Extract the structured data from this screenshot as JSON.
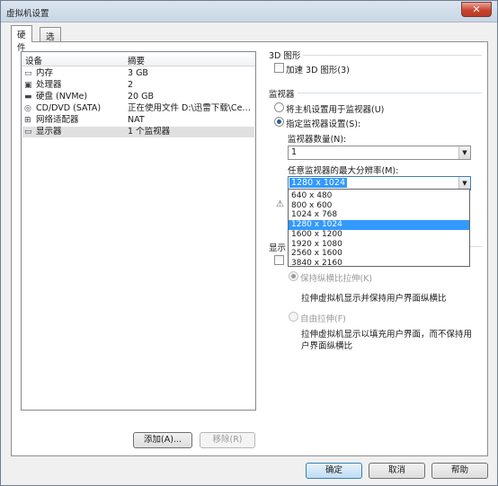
{
  "window": {
    "title": "虚拟机设置",
    "close_glyph": "✕"
  },
  "tabs": [
    {
      "label": "硬件",
      "active": true
    },
    {
      "label": "选项",
      "active": false
    }
  ],
  "device_list": {
    "headers": {
      "device": "设备",
      "summary": "摘要"
    },
    "rows": [
      {
        "icon": "memory-icon",
        "name": "内存",
        "summary": "3 GB"
      },
      {
        "icon": "processor-icon",
        "name": "处理器",
        "summary": "2"
      },
      {
        "icon": "harddisk-icon",
        "name": "硬盘 (NVMe)",
        "summary": "20 GB"
      },
      {
        "icon": "cd-dvd-icon",
        "name": "CD/DVD (SATA)",
        "summary": "正在使用文件 D:\\迅雷下载\\Cen..."
      },
      {
        "icon": "network-adapter-icon",
        "name": "网络适配器",
        "summary": "NAT"
      },
      {
        "icon": "display-icon",
        "name": "显示器",
        "summary": "1 个监视器",
        "selected": true
      }
    ]
  },
  "left_buttons": {
    "add": "添加(A)...",
    "remove": "移除(R)"
  },
  "graphics_3d": {
    "title": "3D 图形",
    "accelerate_label": "加速 3D 图形(3)"
  },
  "monitors": {
    "title": "监视器",
    "use_host_label": "将主机设置用于监视器(U)",
    "specify_label": "指定监视器设置(S):",
    "count_label": "监视器数量(N):",
    "count_value": "1",
    "max_res_label": "任意监视器的最大分辨率(M):",
    "max_res_value": "1280 x 1024",
    "resolution_options": [
      "640 x 480",
      "800 x 600",
      "1024 x 768",
      "1280 x 1024",
      "1600 x 1200",
      "1920 x 1080",
      "2560 x 1600",
      "3840 x 2160"
    ],
    "selected_index": 3,
    "warn_glyph": "⚠"
  },
  "display": {
    "title_partial": "显示",
    "keep_aspect_label": "保持纵横比拉伸(K)",
    "keep_aspect_desc": "拉伸虚拟机显示并保持用户界面纵横比",
    "free_stretch_label": "自由拉伸(F)",
    "free_stretch_desc_1": "拉伸虚拟机显示以填充用户界面，而不保持用",
    "free_stretch_desc_2": "户界面纵横比"
  },
  "footer_buttons": {
    "ok": "确定",
    "cancel": "取消",
    "help": "帮助"
  }
}
